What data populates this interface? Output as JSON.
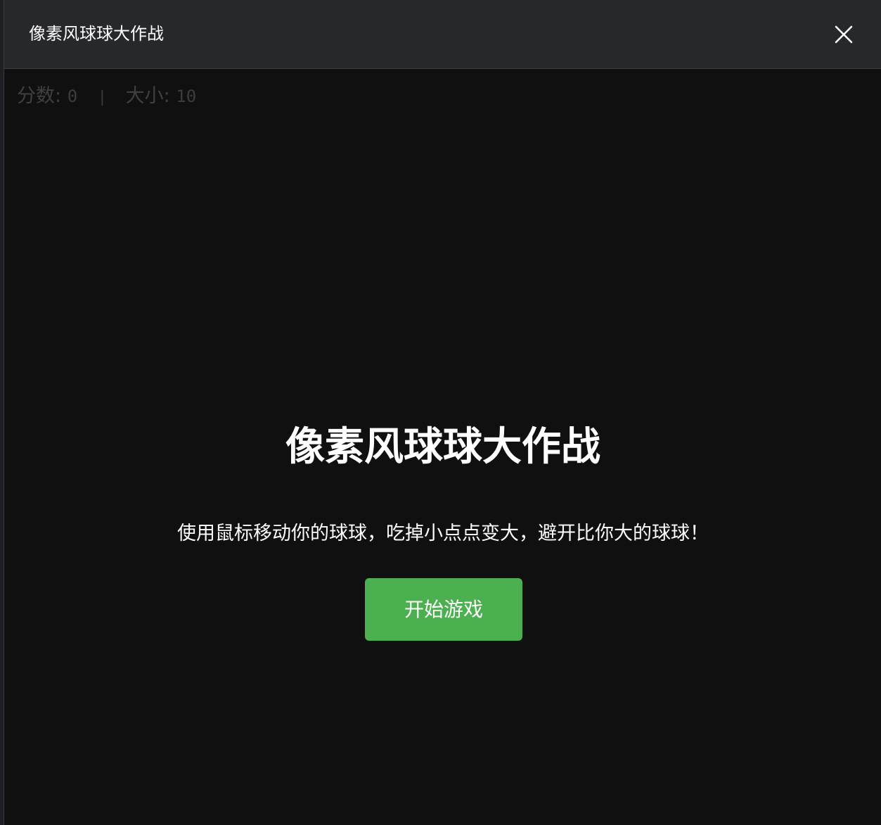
{
  "window": {
    "title": "像素风球球大作战",
    "close_icon": "close-icon"
  },
  "hud": {
    "score_label": "分数:",
    "score_value": "0",
    "separator": "|",
    "size_label": "大小:",
    "size_value": "10"
  },
  "overlay": {
    "title": "像素风球球大作战",
    "description": "使用鼠标移动你的球球，吃掉小点点变大，避开比你大的球球！",
    "start_label": "开始游戏"
  },
  "colors": {
    "background": "#101010",
    "titlebar": "#27282c",
    "accent": "#4caf50",
    "hud_text": "#404040"
  }
}
